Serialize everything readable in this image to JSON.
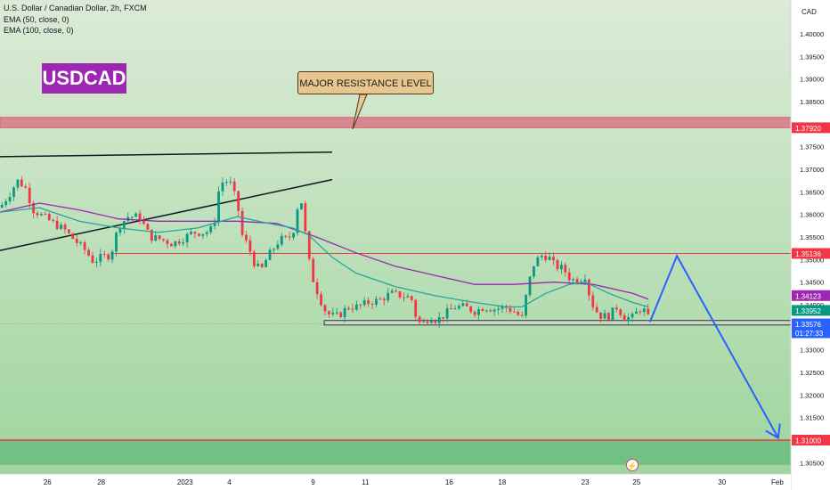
{
  "header": {
    "symbol_line": "U.S. Dollar / Canadian Dollar, 2h, FXCM",
    "ema50_label": "EMA (50, close, 0)",
    "ema100_label": "EMA (100, close, 0)"
  },
  "badge": {
    "text": "USDCAD"
  },
  "callout": {
    "text": "MAJOR RESISTANCE LEVEL"
  },
  "axis": {
    "currency": "CAD",
    "countdown": "01:27:33"
  },
  "colors": {
    "up": "#089981",
    "down": "#f23645",
    "ema50": "#26a69a",
    "ema100": "#9c27b0",
    "projection": "#2962ff",
    "resistance_zone": "#d96b80",
    "support_zone": "#4cae6e",
    "bg_top": "#dcebd7",
    "bg_bottom": "#9fd59e"
  },
  "chart_data": {
    "type": "candlestick",
    "timeframe": "2h",
    "ylim": [
      1.3025,
      1.4075
    ],
    "y_ticks": [
      1.305,
      1.31,
      1.315,
      1.32,
      1.325,
      1.33,
      1.335,
      1.34,
      1.345,
      1.35,
      1.355,
      1.36,
      1.365,
      1.37,
      1.375,
      1.38,
      1.385,
      1.39,
      1.395,
      1.4,
      1.405
    ],
    "x_ticks": [
      {
        "label": "26",
        "t": 0.06
      },
      {
        "label": "28",
        "t": 0.128
      },
      {
        "label": "2023",
        "t": 0.234
      },
      {
        "label": "4",
        "t": 0.29
      },
      {
        "label": "9",
        "t": 0.396
      },
      {
        "label": "11",
        "t": 0.462
      },
      {
        "label": "16",
        "t": 0.568
      },
      {
        "label": "18",
        "t": 0.635
      },
      {
        "label": "23",
        "t": 0.74
      },
      {
        "label": "25",
        "t": 0.805
      },
      {
        "label": "30",
        "t": 0.913
      },
      {
        "label": "Feb",
        "t": 0.983
      }
    ],
    "price_path": [
      [
        0.0,
        1.3615
      ],
      [
        0.012,
        1.3645
      ],
      [
        0.022,
        1.3675
      ],
      [
        0.032,
        1.366
      ],
      [
        0.042,
        1.361
      ],
      [
        0.055,
        1.3595
      ],
      [
        0.068,
        1.358
      ],
      [
        0.082,
        1.3565
      ],
      [
        0.096,
        1.354
      ],
      [
        0.108,
        1.352
      ],
      [
        0.118,
        1.3495
      ],
      [
        0.128,
        1.3505
      ],
      [
        0.14,
        1.351
      ],
      [
        0.15,
        1.3575
      ],
      [
        0.162,
        1.3595
      ],
      [
        0.176,
        1.3595
      ],
      [
        0.19,
        1.355
      ],
      [
        0.204,
        1.3545
      ],
      [
        0.218,
        1.3535
      ],
      [
        0.23,
        1.3545
      ],
      [
        0.244,
        1.356
      ],
      [
        0.26,
        1.356
      ],
      [
        0.27,
        1.357
      ],
      [
        0.278,
        1.367
      ],
      [
        0.29,
        1.3675
      ],
      [
        0.3,
        1.3625
      ],
      [
        0.306,
        1.3555
      ],
      [
        0.314,
        1.353
      ],
      [
        0.322,
        1.349
      ],
      [
        0.33,
        1.3475
      ],
      [
        0.338,
        1.3505
      ],
      [
        0.346,
        1.3525
      ],
      [
        0.354,
        1.3545
      ],
      [
        0.362,
        1.3545
      ],
      [
        0.37,
        1.3555
      ],
      [
        0.376,
        1.3615
      ],
      [
        0.382,
        1.363
      ],
      [
        0.388,
        1.3525
      ],
      [
        0.394,
        1.3465
      ],
      [
        0.402,
        1.3425
      ],
      [
        0.41,
        1.339
      ],
      [
        0.418,
        1.3375
      ],
      [
        0.428,
        1.3375
      ],
      [
        0.44,
        1.3395
      ],
      [
        0.452,
        1.3395
      ],
      [
        0.466,
        1.3405
      ],
      [
        0.48,
        1.341
      ],
      [
        0.494,
        1.3425
      ],
      [
        0.508,
        1.342
      ],
      [
        0.52,
        1.3415
      ],
      [
        0.528,
        1.336
      ],
      [
        0.536,
        1.336
      ],
      [
        0.544,
        1.3375
      ],
      [
        0.552,
        1.3365
      ],
      [
        0.56,
        1.3375
      ],
      [
        0.574,
        1.3395
      ],
      [
        0.588,
        1.3395
      ],
      [
        0.6,
        1.3385
      ],
      [
        0.612,
        1.3395
      ],
      [
        0.626,
        1.339
      ],
      [
        0.638,
        1.3395
      ],
      [
        0.65,
        1.3385
      ],
      [
        0.66,
        1.337
      ],
      [
        0.668,
        1.3445
      ],
      [
        0.676,
        1.3495
      ],
      [
        0.686,
        1.351
      ],
      [
        0.694,
        1.3505
      ],
      [
        0.702,
        1.3485
      ],
      [
        0.712,
        1.348
      ],
      [
        0.722,
        1.3455
      ],
      [
        0.732,
        1.3455
      ],
      [
        0.74,
        1.3465
      ],
      [
        0.746,
        1.3415
      ],
      [
        0.752,
        1.339
      ],
      [
        0.76,
        1.3375
      ],
      [
        0.77,
        1.3375
      ],
      [
        0.78,
        1.3395
      ],
      [
        0.79,
        1.337
      ],
      [
        0.8,
        1.3372
      ],
      [
        0.806,
        1.3385
      ],
      [
        0.812,
        1.3395
      ],
      [
        0.818,
        1.3375
      ],
      [
        0.822,
        1.3364
      ]
    ],
    "ema50_path": [
      [
        0.0,
        1.3605
      ],
      [
        0.05,
        1.3615
      ],
      [
        0.1,
        1.3585
      ],
      [
        0.15,
        1.357
      ],
      [
        0.2,
        1.356
      ],
      [
        0.25,
        1.357
      ],
      [
        0.3,
        1.3595
      ],
      [
        0.34,
        1.358
      ],
      [
        0.37,
        1.357
      ],
      [
        0.39,
        1.3555
      ],
      [
        0.42,
        1.3505
      ],
      [
        0.45,
        1.347
      ],
      [
        0.5,
        1.344
      ],
      [
        0.55,
        1.342
      ],
      [
        0.6,
        1.3405
      ],
      [
        0.64,
        1.3395
      ],
      [
        0.66,
        1.3395
      ],
      [
        0.69,
        1.3425
      ],
      [
        0.72,
        1.3445
      ],
      [
        0.74,
        1.345
      ],
      [
        0.77,
        1.3425
      ],
      [
        0.8,
        1.3405
      ],
      [
        0.82,
        1.3395
      ]
    ],
    "ema100_path": [
      [
        0.0,
        1.3605
      ],
      [
        0.05,
        1.3625
      ],
      [
        0.1,
        1.361
      ],
      [
        0.15,
        1.359
      ],
      [
        0.2,
        1.3585
      ],
      [
        0.25,
        1.3585
      ],
      [
        0.3,
        1.3585
      ],
      [
        0.35,
        1.358
      ],
      [
        0.4,
        1.355
      ],
      [
        0.45,
        1.3515
      ],
      [
        0.5,
        1.3485
      ],
      [
        0.55,
        1.3465
      ],
      [
        0.6,
        1.3445
      ],
      [
        0.65,
        1.3445
      ],
      [
        0.7,
        1.345
      ],
      [
        0.75,
        1.3445
      ],
      [
        0.8,
        1.3425
      ],
      [
        0.82,
        1.3412
      ]
    ],
    "price_tags": [
      {
        "label": "1.37920",
        "value": 1.3792,
        "color": "#f23645"
      },
      {
        "label": "1.35136",
        "value": 1.35136,
        "color": "#f23645"
      },
      {
        "label": "1.34123",
        "value": 1.34123,
        "color": "#9c27b0"
      },
      {
        "label": "1.33952",
        "value": 1.33952,
        "color": "#089981"
      },
      {
        "label": "1.33576",
        "value": 1.33576,
        "color": "#2962ff"
      },
      {
        "label": "1.31000",
        "value": 1.31,
        "color": "#f23645"
      }
    ],
    "resistance_zone": [
      1.3792,
      1.3815
    ],
    "support_level": 1.31,
    "horizontal_level": 1.35136,
    "consolidation_box": [
      1.3355,
      1.3365
    ],
    "trendlines": [
      [
        [
          0.0,
          1.3728
        ],
        [
          0.42,
          1.3738
        ]
      ],
      [
        [
          0.0,
          1.352
        ],
        [
          0.42,
          1.3677
        ]
      ]
    ],
    "projection": [
      [
        0.822,
        1.3362
      ],
      [
        0.856,
        1.3508
      ],
      [
        0.984,
        1.3105
      ]
    ],
    "current_price": 1.33576
  }
}
